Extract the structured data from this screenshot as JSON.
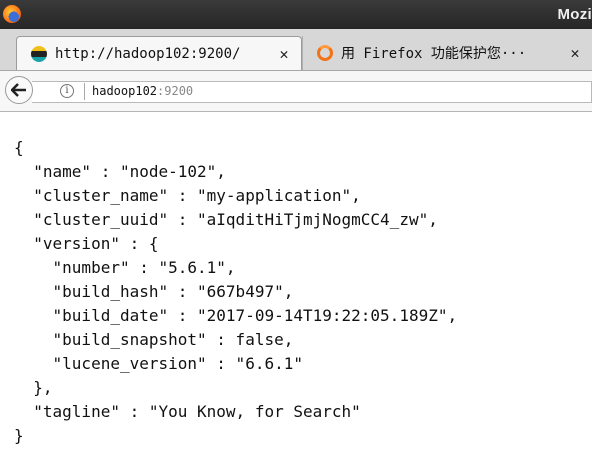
{
  "window": {
    "title": "Mozi"
  },
  "tabs": [
    {
      "label": "http://hadoop102:9200/",
      "icon": "elastic-icon",
      "active": true
    },
    {
      "label": "用 Firefox 功能保护您···",
      "icon": "shield-icon",
      "active": false
    }
  ],
  "navbar": {
    "url_host": "hadoop102",
    "url_port": ":9200"
  },
  "content": {
    "json_text": "{\n  \"name\" : \"node-102\",\n  \"cluster_name\" : \"my-application\",\n  \"cluster_uuid\" : \"aIqditHiTjmjNogmCC4_zw\",\n  \"version\" : {\n    \"number\" : \"5.6.1\",\n    \"build_hash\" : \"667b497\",\n    \"build_date\" : \"2017-09-14T19:22:05.189Z\",\n    \"build_snapshot\" : false,\n    \"lucene_version\" : \"6.6.1\"\n  },\n  \"tagline\" : \"You Know, for Search\"\n}"
  }
}
